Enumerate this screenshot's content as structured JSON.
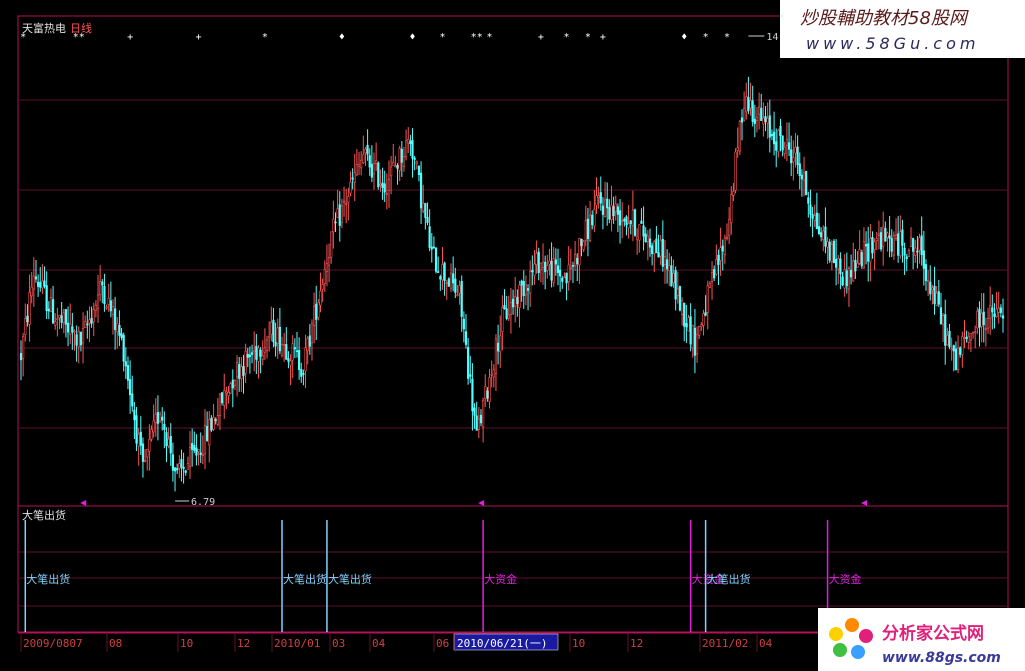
{
  "window": {
    "title": "天富热电",
    "period": "日线"
  },
  "watermarks": {
    "top_line1": "炒股輔助教材58股网",
    "top_line2": "www.58Gu.com",
    "bottom_line1": "分析家公式网",
    "bottom_line2": "www.88gs.com"
  },
  "indicator": {
    "name": "大笔出货"
  },
  "colors": {
    "up": "#ff5555",
    "down": "#54ffff",
    "panel_border": "#b3125a",
    "grid": "#5a0f2a",
    "signal_sell": "#7fd4ff",
    "signal_fund": "#e020e0",
    "axis_text": "#d04040",
    "cursor_box": "#1a1aa0"
  },
  "chart_data": {
    "type": "candlestick",
    "symbol": "天富热电",
    "period": "daily",
    "price_range": [
      6.79,
      14.5
    ],
    "max_label": "14.50",
    "min_label": "6.79",
    "x_ticks": [
      "2009/0807",
      "08",
      "10",
      "12",
      "2010/01",
      "03",
      "04",
      "06",
      "2010/06/21(一)",
      "10",
      "12",
      "2011/02",
      "04"
    ],
    "cursor_label": "2010/06/21(一)",
    "price_path_keyframes": [
      {
        "i": 0,
        "p": 9.2
      },
      {
        "i": 6,
        "p": 10.6
      },
      {
        "i": 15,
        "p": 9.9
      },
      {
        "i": 28,
        "p": 9.4
      },
      {
        "i": 38,
        "p": 10.4
      },
      {
        "i": 48,
        "p": 9.3
      },
      {
        "i": 57,
        "p": 7.2
      },
      {
        "i": 65,
        "p": 8.3
      },
      {
        "i": 73,
        "p": 7.1
      },
      {
        "i": 85,
        "p": 7.7
      },
      {
        "i": 100,
        "p": 8.9
      },
      {
        "i": 118,
        "p": 9.6
      },
      {
        "i": 132,
        "p": 9.0
      },
      {
        "i": 145,
        "p": 11.2
      },
      {
        "i": 160,
        "p": 12.6
      },
      {
        "i": 170,
        "p": 12.1
      },
      {
        "i": 182,
        "p": 12.9
      },
      {
        "i": 192,
        "p": 10.9
      },
      {
        "i": 205,
        "p": 10.2
      },
      {
        "i": 213,
        "p": 7.8
      },
      {
        "i": 225,
        "p": 9.8
      },
      {
        "i": 242,
        "p": 10.8
      },
      {
        "i": 255,
        "p": 10.5
      },
      {
        "i": 270,
        "p": 11.8
      },
      {
        "i": 285,
        "p": 11.5
      },
      {
        "i": 300,
        "p": 10.9
      },
      {
        "i": 315,
        "p": 9.4
      },
      {
        "i": 330,
        "p": 11.3
      },
      {
        "i": 338,
        "p": 13.6
      },
      {
        "i": 350,
        "p": 13.0
      },
      {
        "i": 362,
        "p": 12.6
      },
      {
        "i": 372,
        "p": 11.4
      },
      {
        "i": 385,
        "p": 10.5
      },
      {
        "i": 400,
        "p": 11.2
      },
      {
        "i": 420,
        "p": 11.0
      },
      {
        "i": 436,
        "p": 9.1
      },
      {
        "i": 448,
        "p": 9.8
      },
      {
        "i": 459,
        "p": 9.9
      }
    ],
    "top_markers": [
      {
        "i": 1,
        "s": "*"
      },
      {
        "i": 27,
        "s": "**"
      },
      {
        "i": 51,
        "s": "+"
      },
      {
        "i": 83,
        "s": "+"
      },
      {
        "i": 114,
        "s": "*"
      },
      {
        "i": 150,
        "s": "♦"
      },
      {
        "i": 183,
        "s": "♦"
      },
      {
        "i": 197,
        "s": "*"
      },
      {
        "i": 213,
        "s": "**"
      },
      {
        "i": 219,
        "s": "*"
      },
      {
        "i": 243,
        "s": "+"
      },
      {
        "i": 255,
        "s": "*"
      },
      {
        "i": 265,
        "s": "*"
      },
      {
        "i": 272,
        "s": "+"
      },
      {
        "i": 310,
        "s": "♦"
      },
      {
        "i": 320,
        "s": "*"
      },
      {
        "i": 330,
        "s": "*"
      }
    ],
    "range_markers": [
      {
        "i": 30
      },
      {
        "i": 216
      },
      {
        "i": 395
      }
    ],
    "signals": [
      {
        "i": 2,
        "label": "大笔出货",
        "kind": "sell"
      },
      {
        "i": 122,
        "label": "大笔出货",
        "kind": "sell"
      },
      {
        "i": 143,
        "label": "大笔出货",
        "kind": "sell"
      },
      {
        "i": 216,
        "label": "大资金",
        "kind": "fund"
      },
      {
        "i": 313,
        "label": "大资金",
        "kind": "fund"
      },
      {
        "i": 320,
        "label": "大笔出货",
        "kind": "sell"
      },
      {
        "i": 377,
        "label": "大资金",
        "kind": "fund"
      }
    ]
  }
}
